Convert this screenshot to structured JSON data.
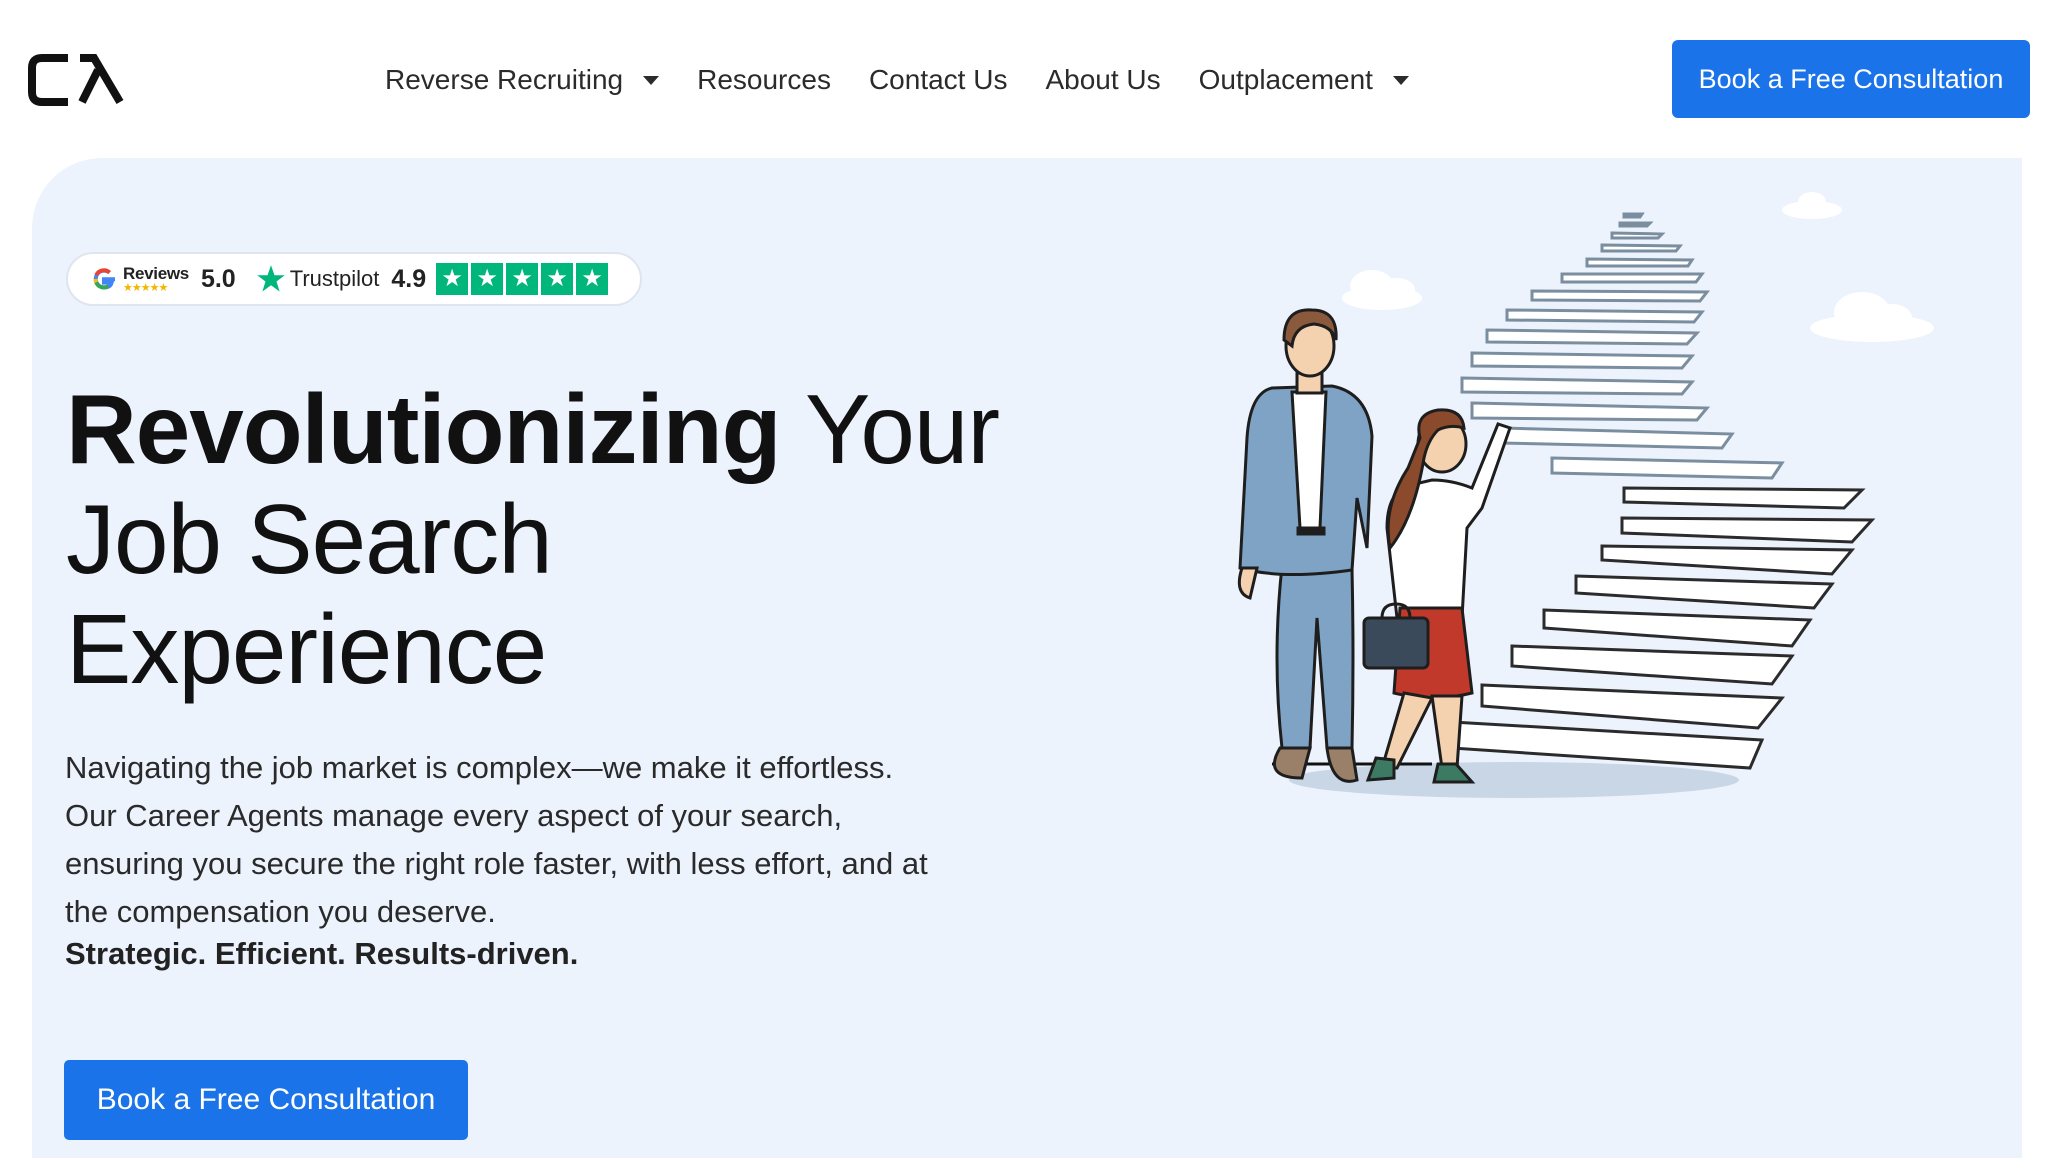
{
  "brand": {
    "logo_text": "CA"
  },
  "nav": {
    "items": [
      {
        "label": "Reverse Recruiting",
        "has_dropdown": true
      },
      {
        "label": "Resources",
        "has_dropdown": false
      },
      {
        "label": "Contact Us",
        "has_dropdown": false
      },
      {
        "label": "About Us",
        "has_dropdown": false
      },
      {
        "label": "Outplacement",
        "has_dropdown": true
      }
    ],
    "cta_label": "Book a Free Consultation"
  },
  "reviews": {
    "google_label": "Reviews",
    "google_score": "5.0",
    "trustpilot_label": "Trustpilot",
    "trustpilot_score": "4.9",
    "trustpilot_stars": 5
  },
  "hero": {
    "headline_strong": "Revolutionizing",
    "headline_line1_rest": " Your",
    "headline_line2": "Job Search",
    "headline_line3": "Experience",
    "description": "Navigating the job market is complex—we make it effortless. Our Career Agents manage every aspect of your search, ensuring you secure the right role faster, with less effort, and at the compensation you deserve.",
    "tagline": "Strategic. Efficient. Results-driven.",
    "cta_label": "Book a Free Consultation"
  },
  "colors": {
    "primary": "#1a73e8",
    "hero_bg": "#edf3fd",
    "trustpilot_green": "#00b67a",
    "skirt_red": "#c0392b",
    "suit_blue": "#7fa3c5"
  }
}
